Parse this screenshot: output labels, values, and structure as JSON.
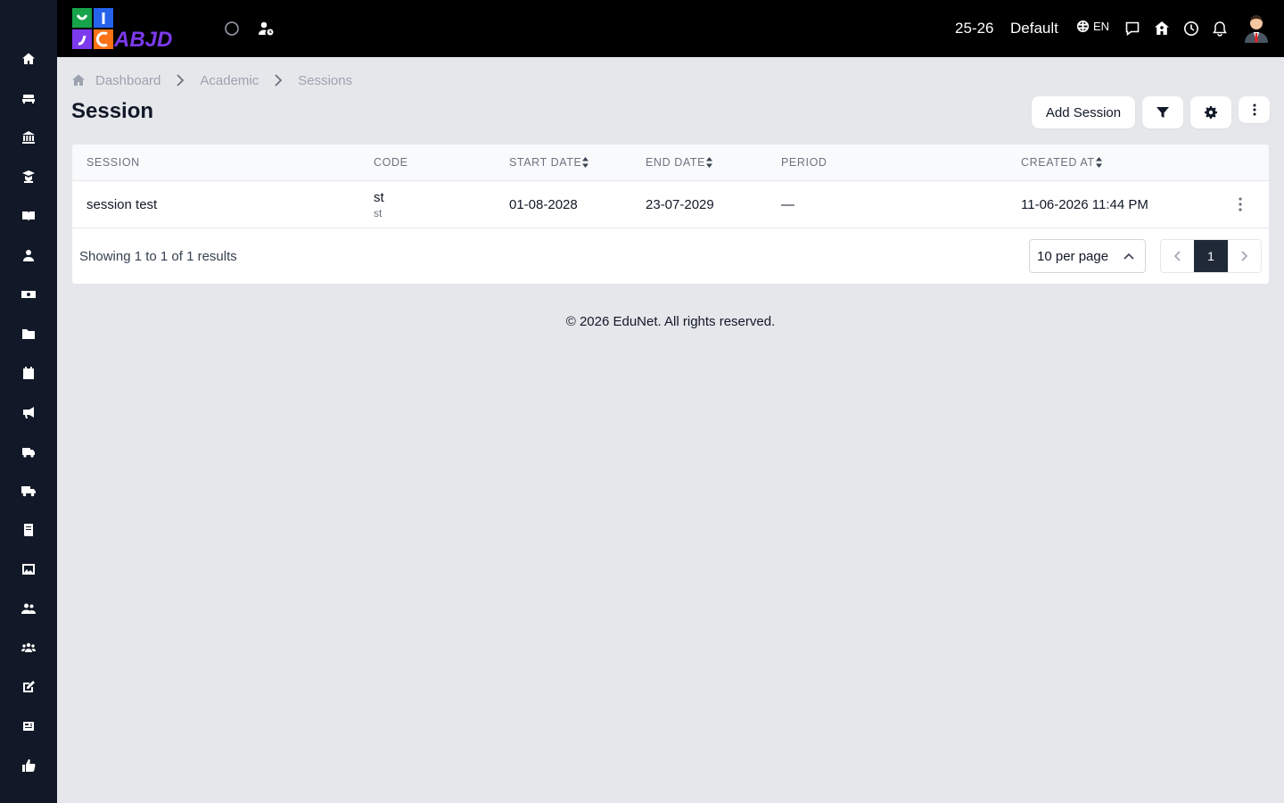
{
  "topbar": {
    "session_year": "25-26",
    "profile_name": "Default",
    "language": "EN",
    "logo_text": "ABJD"
  },
  "breadcrumb": {
    "items": [
      "Dashboard",
      "Academic",
      "Sessions"
    ]
  },
  "page": {
    "title": "Session",
    "add_button": "Add Session"
  },
  "table": {
    "columns": [
      "SESSION",
      "CODE",
      "START DATE",
      "END DATE",
      "PERIOD",
      "CREATED AT"
    ],
    "rows": [
      {
        "session": "session test",
        "code": "st",
        "code_sub": "st",
        "start_date": "01-08-2028",
        "end_date": "23-07-2029",
        "period": "—",
        "created_at": "11-06-2026 11:44 PM"
      }
    ],
    "summary": "Showing 1 to 1 of 1 results",
    "per_page": "10 per page",
    "current_page": "1"
  },
  "footer": {
    "text": "© 2026 EduNet. All rights reserved."
  },
  "colors": {
    "sidebar_bg": "#111827",
    "topbar_bg": "#000000",
    "page_bg": "#e5e7eb",
    "active_page_bg": "#1f2937"
  },
  "sidebar": {
    "icons": [
      "home-icon",
      "sofa-icon",
      "bank-icon",
      "graduation-icon",
      "book-open-icon",
      "user-icon",
      "money-icon",
      "folder-icon",
      "calendar-icon",
      "megaphone-icon",
      "bus-icon",
      "truck-icon",
      "book-icon",
      "image-icon",
      "users-icon",
      "group-icon",
      "edit-icon",
      "newspaper-icon",
      "thumbs-up-icon"
    ]
  }
}
